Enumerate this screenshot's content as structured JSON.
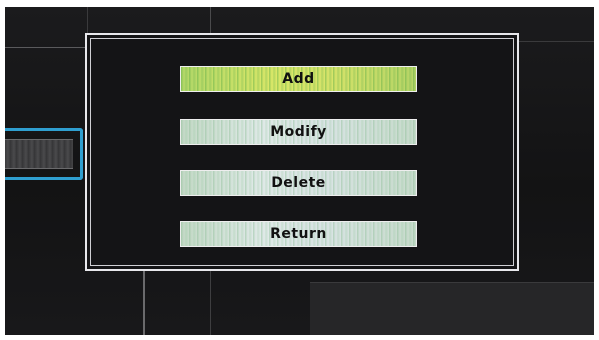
{
  "menu": {
    "items": [
      {
        "label": "Add",
        "selected": true
      },
      {
        "label": "Modify",
        "selected": false
      },
      {
        "label": "Delete",
        "selected": false
      },
      {
        "label": "Return",
        "selected": false
      }
    ]
  },
  "colors": {
    "background": "#151517",
    "dialog_border": "#e8e8ec",
    "highlight_button": "#dfe76c",
    "normal_button": "#dfe6ea",
    "side_selection": "#2f9fd0"
  }
}
